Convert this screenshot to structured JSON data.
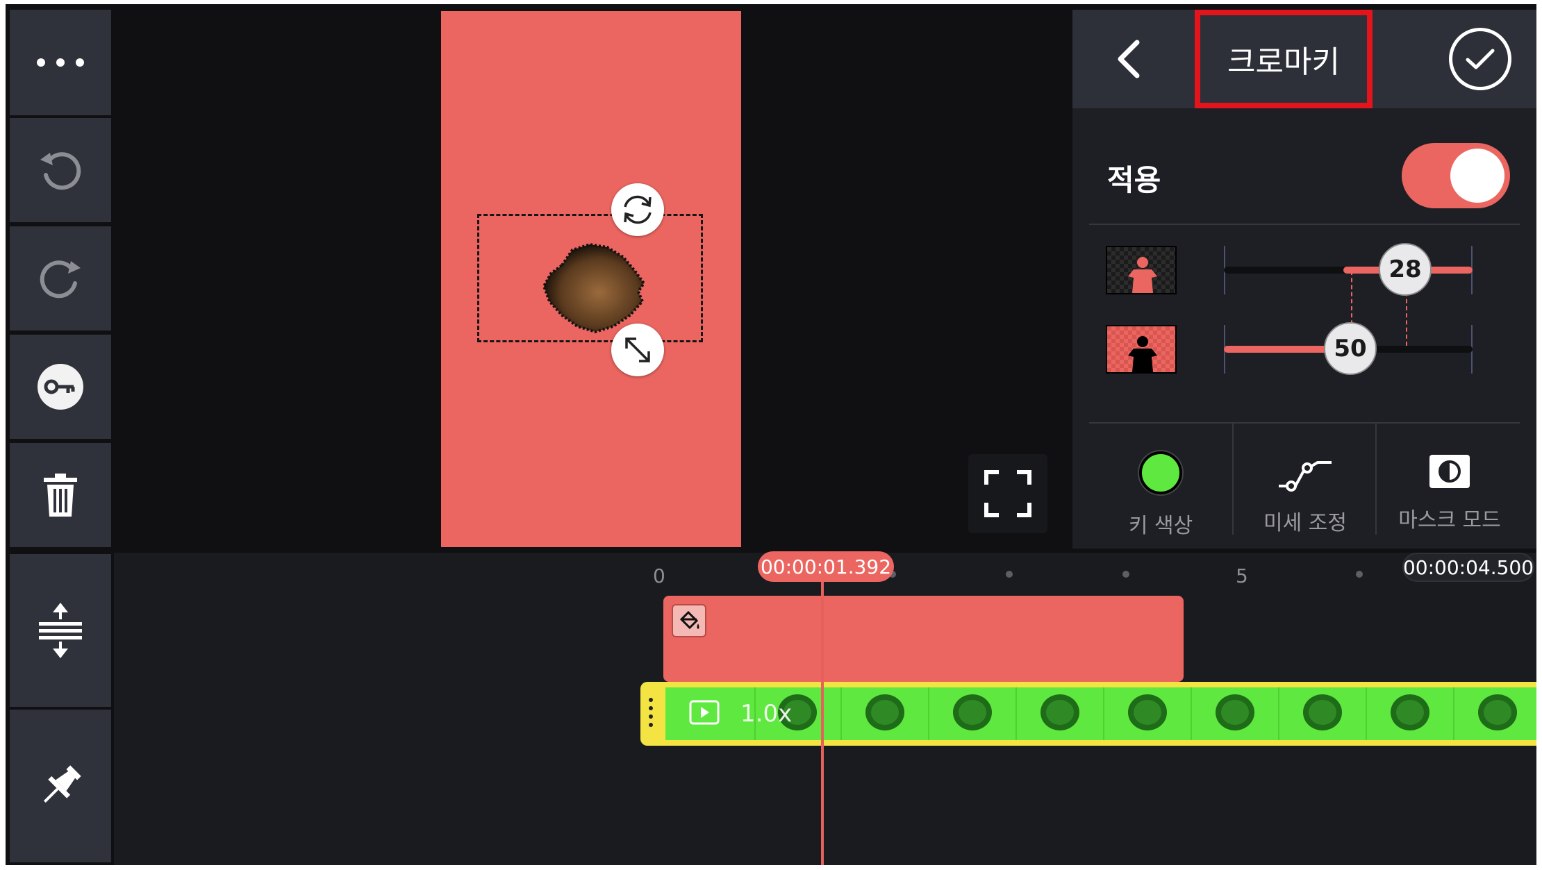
{
  "panel": {
    "title": "크로마키",
    "apply_label": "적용",
    "apply_on": true,
    "sliders": [
      {
        "name": "foreground-threshold",
        "value": "28"
      },
      {
        "name": "background-threshold",
        "value": "50"
      }
    ],
    "tools": [
      {
        "label": "키 색상",
        "icon": "key-color-swatch",
        "color": "#5fe83f"
      },
      {
        "label": "미세 조정",
        "icon": "curve-adjust-icon"
      },
      {
        "label": "마스크 모드",
        "icon": "mask-mode-icon"
      }
    ]
  },
  "left_toolbar": [
    {
      "icon": "more-icon"
    },
    {
      "icon": "undo-icon"
    },
    {
      "icon": "redo-icon"
    },
    {
      "icon": "keyframe-icon"
    },
    {
      "icon": "delete-icon"
    },
    {
      "icon": "expand-track-icon"
    },
    {
      "icon": "pin-icon"
    }
  ],
  "timeline": {
    "ruler_start": "0",
    "ruler_mark": "5",
    "playhead_time": "00:00:01.392",
    "end_time": "00:00:04.500",
    "video_speed": "1.0x"
  },
  "colors": {
    "accent": "#ec6661",
    "chroma_key": "#5fe83f",
    "highlight_box": "#e4141c"
  }
}
